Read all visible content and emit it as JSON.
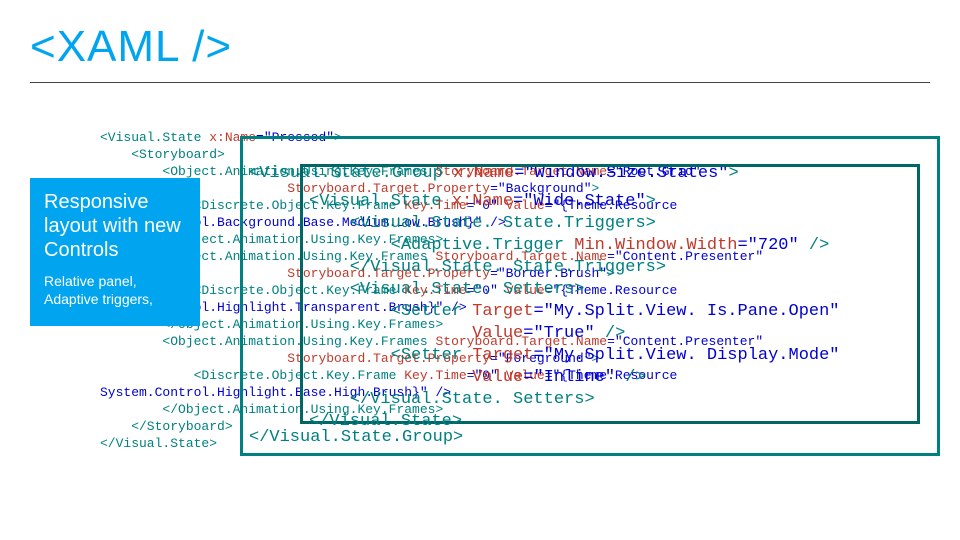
{
  "title": "<XAML />",
  "side": {
    "h1": "Responsive layout with new Controls",
    "p1": "Relative panel, Adaptive triggers,"
  },
  "code": {
    "l1a": "<Visual.State ",
    "l1b": "x:Name",
    "l1c": "=\"Pressed\"",
    "l1d": ">",
    "l2a": "    <Storyboard>",
    "l3a": "        <Object.Animation.Using.Key.Frames ",
    "l3b": "Storyboard.Target.Name",
    "l3c": "=\"Root.Grid\"",
    "l4a": "                        ",
    "l4b": "Storyboard.Target.Property",
    "l4c": "=\"Background\"",
    "l4d": ">",
    "l5a": "            <Discrete.Object.Key.Frame ",
    "l5b": "Key.Time",
    "l5c": "=\"0\" ",
    "l5d": "Value",
    "l5e": "=\"{Theme.Resource",
    "l6a": "System.Control.Background.Base.Medium.Low.Brush}\" />",
    "l7a": "        </Object.Animation.Using.Key.Frames>",
    "l8a": "        <Object.Animation.Using.Key.Frames ",
    "l8b": "Storyboard.Target.Name",
    "l8c": "=\"Content.Presenter\"",
    "l9a": "                        ",
    "l9b": "Storyboard.Target.Property",
    "l9c": "=\"Border.Brush\"",
    "l9d": ">",
    "l10a": "            <Discrete.Object.Key.Frame ",
    "l10b": "Key.Time",
    "l10c": "=\"0\" ",
    "l10d": "Value",
    "l10e": "=\"{Theme.Resource",
    "l11a": "System.Control.Highlight.Transparent.Brush}\" />",
    "l12a": "        </Object.Animation.Using.Key.Frames>",
    "l13a": "        <Object.Animation.Using.Key.Frames ",
    "l13b": "Storyboard.Target.Name",
    "l13c": "=\"Content.Presenter\"",
    "l14a": "                        ",
    "l14b": "Storyboard.Target.Property",
    "l14c": "=\"Foreground\"",
    "l14d": ">",
    "l15a": "            <Discrete.Object.Key.Frame ",
    "l15b": "Key.Time",
    "l15c": "=\"0\" ",
    "l15d": "Value",
    "l15e": "=\"{Theme.Resource",
    "l16a": "System.Control.Highlight.Base.High.Brush}\" />",
    "l17a": "        </Object.Animation.Using.Key.Frames>",
    "l18a": "    </Storyboard>",
    "l19a": "</Visual.State>"
  },
  "ov1": {
    "l1": "<Visual.State.Group ",
    "l1b": "x:Name",
    "l1c": "=\"Window.Size.States\"",
    "l1d": ">",
    "l11": "</Visual.State.Group>"
  },
  "ov2": {
    "l1": "<Visual.State ",
    "l1b": "x:Name",
    "l1c": "=\"Wide.State\"",
    "l1d": ">",
    "l2": "    <Visual.State. State.Triggers>",
    "l3": "        <Adaptive.Trigger ",
    "l3b": "Min.Window.Width",
    "l3c": "=\"720\" ",
    "l3d": "/>",
    "l4": "    </Visual.State. State.Triggers>",
    "l5": "    <Visual.State. Setters>",
    "l6": "        <Setter ",
    "l6b": "Target",
    "l6c": "=\"My.Split.View. Is.Pane.Open\"",
    "l7": "                ",
    "l7b": "Value",
    "l7c": "=\"True\" ",
    "l7d": "/>",
    "l8": "        <Setter ",
    "l8b": "Target",
    "l8c": "=\"My.Split.View. Display.Mode\"",
    "l9": "                ",
    "l9b": "Value",
    "l9c": "=\"Inline\" ",
    "l9d": "/>",
    "l10": "    </Visual.State. Setters>",
    "l11": "</Visual.State>"
  }
}
